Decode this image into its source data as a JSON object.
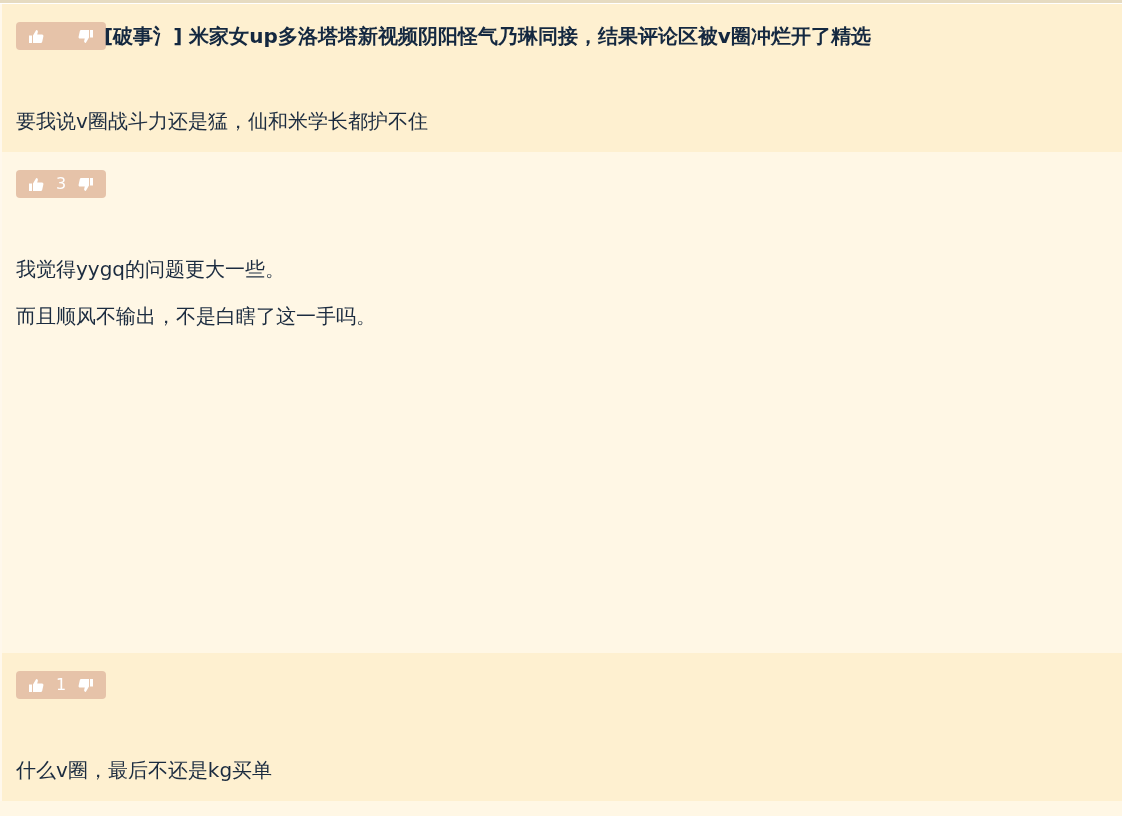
{
  "posts": [
    {
      "title": "[破事氵] 米家女up多洛塔塔新视频阴阳怪气乃琳同接，结果评论区被v圈冲烂开了精选",
      "body": [
        "要我说v圈战斗力还是猛，仙和米学长都护不住"
      ]
    },
    {
      "votes": "3",
      "body": [
        "我觉得yygq的问题更大一些。",
        "而且顺风不输出，不是白瞎了这一手吗。"
      ]
    },
    {
      "votes": "1",
      "body": [
        "什么v圈，最后不还是kg买单"
      ]
    }
  ]
}
